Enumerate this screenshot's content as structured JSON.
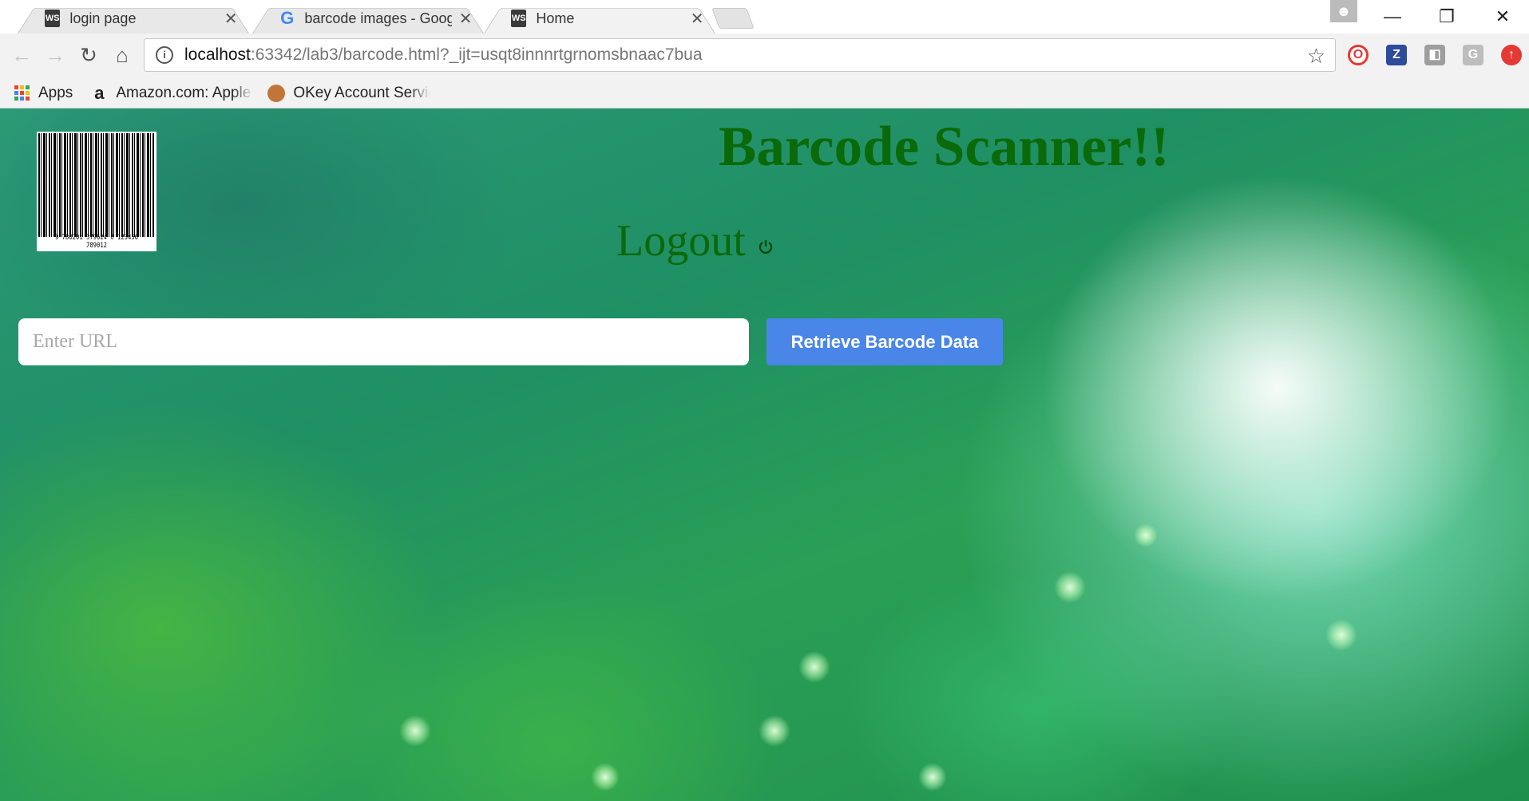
{
  "browser": {
    "tabs": [
      {
        "title": "login page",
        "favicon": "ws-icon",
        "close": "✕"
      },
      {
        "title": "barcode images - Google",
        "favicon": "google-icon",
        "close": "✕"
      },
      {
        "title": "Home",
        "favicon": "ws-icon",
        "close": "✕"
      }
    ],
    "window_controls": {
      "minimize": "—",
      "restore": "❐",
      "close": "✕"
    },
    "url_host": "localhost",
    "url_rest": ":63342/lab3/barcode.html?_ijt=usqt8innnrtgrnomsbnaac7bua",
    "bookmarks": [
      {
        "label": "Apps",
        "icon": "apps-grid-icon"
      },
      {
        "label": "Amazon.com: Apple i",
        "icon": "amazon-icon"
      },
      {
        "label": "OKey Account Service",
        "icon": "okey-icon"
      }
    ],
    "extensions": [
      {
        "name": "opera-icon",
        "glyph": "O",
        "color": "#e53935"
      },
      {
        "name": "z-extension-icon",
        "glyph": "Z",
        "color": "#2e4a9a"
      },
      {
        "name": "grey-extension-icon",
        "glyph": "◧",
        "color": "#9e9e9e"
      },
      {
        "name": "g-extension-icon",
        "glyph": "G",
        "color": "#bdbdbd"
      },
      {
        "name": "red-upload-icon",
        "glyph": "⬆",
        "color": "#e53935"
      }
    ]
  },
  "page": {
    "title": "Barcode Scanner!!",
    "logout_label": "Logout",
    "barcode_digits": "9 780201 379624 0 123456 789012",
    "url_input_placeholder": "Enter URL",
    "retrieve_button": "Retrieve Barcode Data",
    "colors": {
      "title_green": "#0a6a0a",
      "button_blue": "#4a86e8"
    }
  }
}
